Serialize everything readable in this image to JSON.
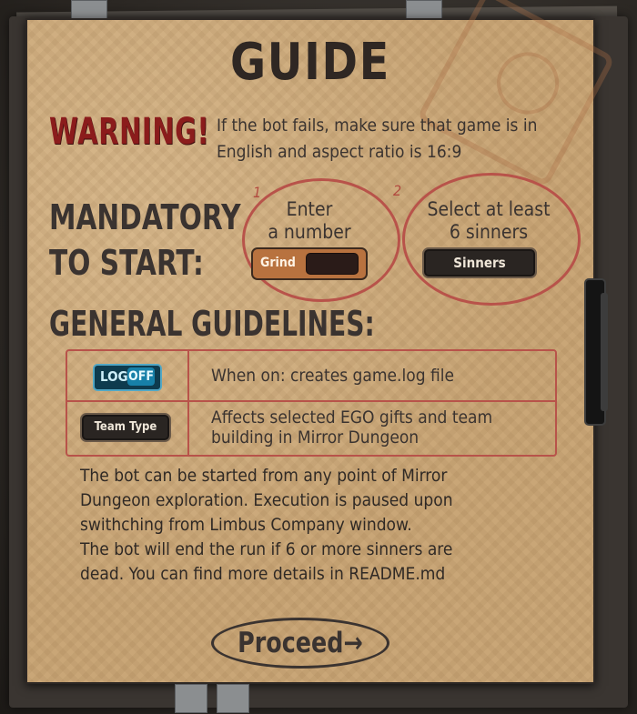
{
  "title": "GUIDE",
  "warning": {
    "label": "WARNING!",
    "text": "If the bot fails, make sure that game is in English and aspect ratio is 16:9"
  },
  "mandatory": {
    "heading_line1": "MANDATORY",
    "heading_line2": "TO START:",
    "step1": {
      "number": "1",
      "text_line1": "Enter",
      "text_line2": "a number",
      "button_label": "Grind"
    },
    "step2": {
      "number": "2",
      "text_line1": "Select at least",
      "text_line2": "6 sinners",
      "button_label": "Sinners"
    }
  },
  "guidelines": {
    "heading": "GENERAL GUIDELINES:",
    "rows": [
      {
        "toggle_left": "LOG",
        "toggle_right": "OFF",
        "text": "When on: creates game.log file"
      },
      {
        "button_label": "Team Type",
        "text_line1": "Affects selected EGO gifts and team",
        "text_line2": "building in Mirror Dungeon"
      }
    ]
  },
  "paragraph": {
    "line1": "The bot can be started from any point of Mirror",
    "line2": "Dungeon exploration. Execution is paused upon",
    "line3": "swithching from Limbus Company window.",
    "line4": "The bot will end the run if 6 or more sinners are",
    "line5": "dead. You can find more details in README.md"
  },
  "proceed_label": "Proceed→",
  "colors": {
    "paper": "#c9a677",
    "ink": "#3a3330",
    "warning_red": "#8b1c1c",
    "marker_red": "#b8534a",
    "toggle_blue": "#1780a8"
  }
}
